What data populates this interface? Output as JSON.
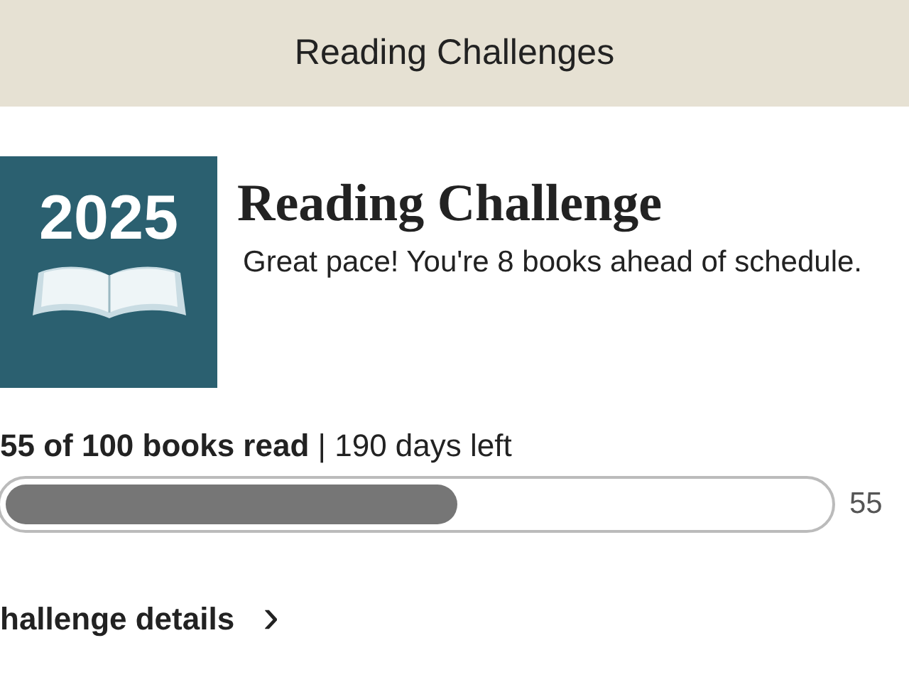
{
  "header": {
    "title": "Reading Challenges"
  },
  "challenge": {
    "cover_year": "2025",
    "title": "Reading Challenge",
    "message": "Great pace! You're 8 books ahead of schedule."
  },
  "progress": {
    "summary": "**55 of 100 books read** | 190 days left",
    "level": 0.55,
    "percent": "55"
  },
  "details_link": {
    "label": "hallenge details",
    "chevron": "›"
  }
}
